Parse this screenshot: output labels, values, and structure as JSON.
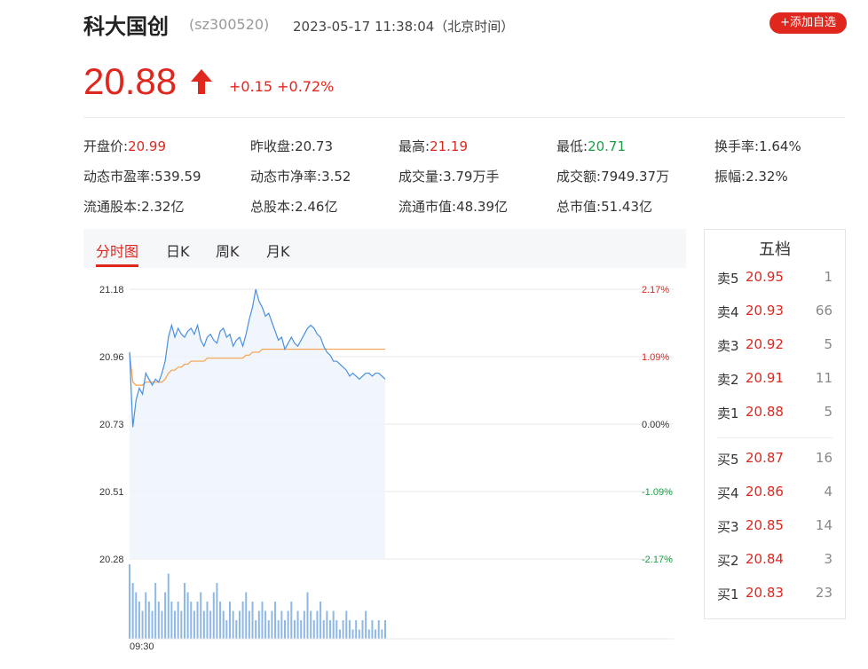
{
  "header": {
    "name": "科大国创",
    "code": "(sz300520)",
    "timestamp": "2023-05-17 11:38:04（北京时间）",
    "add_button": "+添加自选"
  },
  "quote": {
    "price": "20.88",
    "change": "+0.15 +0.72%",
    "up_color": "#e0271e"
  },
  "stats": {
    "open": {
      "label": "开盘价:",
      "value": "20.99"
    },
    "prev_close": {
      "label": "昨收盘:",
      "value": "20.73"
    },
    "high": {
      "label": "最高:",
      "value": "21.19"
    },
    "low": {
      "label": "最低:",
      "value": "20.71"
    },
    "turnover_rate": {
      "label": "换手率:",
      "value": "1.64%"
    },
    "pe": {
      "label": "动态市盈率:",
      "value": "539.59"
    },
    "pb": {
      "label": "动态市净率:",
      "value": "3.52"
    },
    "volume": {
      "label": "成交量:",
      "value": "3.79万手"
    },
    "amount": {
      "label": "成交额:",
      "value": "7949.37万"
    },
    "amplitude": {
      "label": "振幅:",
      "value": "2.32%"
    },
    "float_shares": {
      "label": "流通股本:",
      "value": "2.32亿"
    },
    "total_shares": {
      "label": "总股本:",
      "value": "2.46亿"
    },
    "float_cap": {
      "label": "流通市值:",
      "value": "48.39亿"
    },
    "total_cap": {
      "label": "总市值:",
      "value": "51.43亿"
    }
  },
  "tabs": [
    "分时图",
    "日K",
    "周K",
    "月K"
  ],
  "orderbook": {
    "title": "五档",
    "asks": [
      {
        "label": "卖5",
        "price": "20.95",
        "vol": "1"
      },
      {
        "label": "卖4",
        "price": "20.93",
        "vol": "66"
      },
      {
        "label": "卖3",
        "price": "20.92",
        "vol": "5"
      },
      {
        "label": "卖2",
        "price": "20.91",
        "vol": "11"
      },
      {
        "label": "卖1",
        "price": "20.88",
        "vol": "5"
      }
    ],
    "bids": [
      {
        "label": "买5",
        "price": "20.87",
        "vol": "16"
      },
      {
        "label": "买4",
        "price": "20.86",
        "vol": "4"
      },
      {
        "label": "买3",
        "price": "20.85",
        "vol": "14"
      },
      {
        "label": "买2",
        "price": "20.84",
        "vol": "3"
      },
      {
        "label": "买1",
        "price": "20.83",
        "vol": "23"
      }
    ]
  },
  "chart_data": {
    "type": "line",
    "title": "",
    "price_ticks": [
      "21.18",
      "20.96",
      "20.73",
      "20.51",
      "20.28"
    ],
    "pct_ticks": [
      "2.17%",
      "1.09%",
      "0.00%",
      "-1.09%",
      "-2.17%"
    ],
    "pct_colors": [
      "#e0271e",
      "#e0271e",
      "#333333",
      "#17a046",
      "#17a046"
    ],
    "x_label": "09:30",
    "ylim": [
      20.28,
      21.18
    ],
    "session_minutes": 240,
    "series": [
      {
        "color": "#4a8fe0",
        "values": [
          20.97,
          20.72,
          20.81,
          20.85,
          20.83,
          20.9,
          20.88,
          20.86,
          20.88,
          20.87,
          20.9,
          20.94,
          21.02,
          21.06,
          21.02,
          21.05,
          21.03,
          21.02,
          21.04,
          21.05,
          21.03,
          21.06,
          21.01,
          20.99,
          21.02,
          21.03,
          21.01,
          21.0,
          21.04,
          21.05,
          21.02,
          21.03,
          20.99,
          21.01,
          21.02,
          20.99,
          21.03,
          21.08,
          21.12,
          21.18,
          21.14,
          21.12,
          21.09,
          21.1,
          21.07,
          21.04,
          21.01,
          21.02,
          20.98,
          21.0,
          21.02,
          21.0,
          20.99,
          21.01,
          21.03,
          21.05,
          21.06,
          21.05,
          21.03,
          21.02,
          20.99,
          20.97,
          20.96,
          20.94,
          20.94,
          20.93,
          20.92,
          20.91,
          20.89,
          20.9,
          20.89,
          20.88,
          20.89,
          20.9,
          20.9,
          20.89,
          20.9,
          20.9,
          20.89,
          20.88
        ]
      },
      {
        "color": "#f5a04a",
        "values": [
          20.97,
          20.87,
          20.86,
          20.86,
          20.86,
          20.87,
          20.87,
          20.87,
          20.87,
          20.87,
          20.87,
          20.88,
          20.9,
          20.91,
          20.91,
          20.92,
          20.92,
          20.93,
          20.93,
          20.94,
          20.94,
          20.94,
          20.94,
          20.94,
          20.95,
          20.95,
          20.95,
          20.95,
          20.95,
          20.95,
          20.95,
          20.95,
          20.95,
          20.95,
          20.95,
          20.95,
          20.96,
          20.96,
          20.97,
          20.97,
          20.97,
          20.98,
          20.98,
          20.98,
          20.98,
          20.98,
          20.98,
          20.98,
          20.98,
          20.98,
          20.98,
          20.98,
          20.98,
          20.98,
          20.98,
          20.98,
          20.98,
          20.98,
          20.98,
          20.98,
          20.98,
          20.98,
          20.98,
          20.98,
          20.98,
          20.98,
          20.98,
          20.98,
          20.98,
          20.98,
          20.98,
          20.98,
          20.98,
          20.98,
          20.98,
          20.98,
          20.98,
          20.98,
          20.98,
          20.98
        ]
      }
    ],
    "volume": [
      8,
      6,
      5,
      4,
      3,
      5,
      4,
      3,
      6,
      4,
      3,
      5,
      7,
      4,
      3,
      4,
      3,
      6,
      5,
      4,
      3,
      4,
      5,
      3,
      4,
      3,
      5,
      6,
      4,
      3,
      2,
      4,
      3,
      2,
      3,
      4,
      5,
      3,
      4,
      2,
      3,
      4,
      3,
      2,
      3,
      4,
      2,
      3,
      2,
      3,
      4,
      2,
      3,
      2,
      3,
      5,
      3,
      2,
      3,
      4,
      2,
      3,
      2,
      3,
      2,
      1,
      2,
      3,
      2,
      1,
      2,
      1,
      2,
      3,
      1,
      2,
      1,
      2,
      1,
      2
    ],
    "colors": {
      "grid": "#e8e8e8",
      "area_fill": "#eef4fb"
    }
  }
}
